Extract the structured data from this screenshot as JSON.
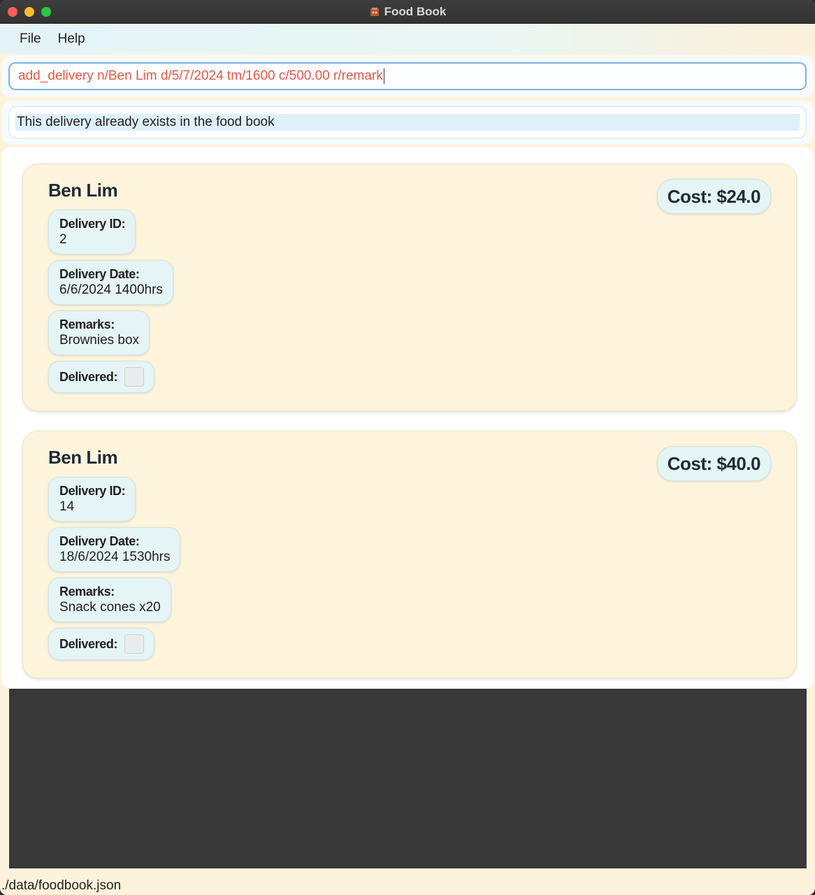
{
  "window": {
    "title": "Food Book",
    "app_icon": "food-book-app-icon"
  },
  "menu": {
    "items": [
      "File",
      "Help"
    ]
  },
  "command_box": {
    "value": "add_delivery n/Ben Lim d/5/7/2024 tm/1600 c/500.00 r/remark"
  },
  "result": {
    "message": "This delivery already exists in the food book"
  },
  "deliveries": [
    {
      "name": "Ben Lim",
      "cost": "Cost: $24.0",
      "id_label": "Delivery ID:",
      "id": "2",
      "date_label": "Delivery Date:",
      "date": "6/6/2024 1400hrs",
      "remarks_label": "Remarks:",
      "remarks": "Brownies box",
      "delivered_label": "Delivered:",
      "delivered": false
    },
    {
      "name": "Ben Lim",
      "cost": "Cost: $40.0",
      "id_label": "Delivery ID:",
      "id": "14",
      "date_label": "Delivery Date:",
      "date": "18/6/2024 1530hrs",
      "remarks_label": "Remarks:",
      "remarks": "Snack cones x20",
      "delivered_label": "Delivered:",
      "delivered": false
    }
  ],
  "status_bar": {
    "path": "./data/foodbook.json"
  }
}
